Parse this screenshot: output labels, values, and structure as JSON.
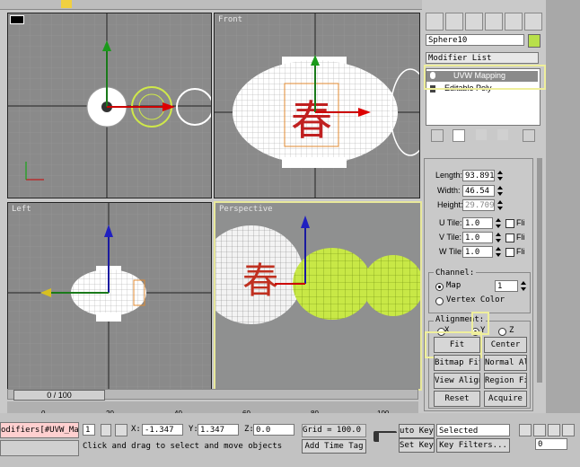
{
  "app": {
    "accent": "#e8e89a",
    "object_color": "#b8e04a"
  },
  "viewports": {
    "top_right_label": "Front",
    "bottom_left_label": "Left",
    "bottom_right_label": "Perspective",
    "lantern_text": "春"
  },
  "command_panel": {
    "object_name": "Sphere10",
    "modifier_list_label": "Modifier List",
    "stack": [
      {
        "label": "UVW Mapping"
      },
      {
        "label": "Editable Poly"
      }
    ]
  },
  "params": {
    "length_label": "Length:",
    "length_value": "93.891",
    "width_label": "Width:",
    "width_value": "46.54",
    "height_label": "Height:",
    "height_value": "29.709",
    "utile_label": "U Tile:",
    "utile_value": "1.0",
    "vtile_label": "V Tile:",
    "vtile_value": "1.0",
    "wtile_label": "W Tile:",
    "wtile_value": "1.0",
    "flip_label": "Fli",
    "channel_label": "Channel:",
    "map_label": "Map",
    "map_value": "1",
    "vertex_color_label": "Vertex Color",
    "alignment_label": "Alignment:",
    "align_x": "X",
    "align_y": "Y",
    "align_z": "Z",
    "fit_label": "Fit",
    "center_label": "Center",
    "bitmap_fit_label": "Bitmap Fit",
    "normal_align_label": "Normal Align",
    "view_align_label": "View Align",
    "region_fit_label": "Region Fit",
    "reset_label": "Reset",
    "acquire_label": "Acquire"
  },
  "timeline": {
    "frame_label": "0 / 100",
    "ticks": [
      "0",
      "20",
      "40",
      "60",
      "80",
      "100"
    ]
  },
  "status": {
    "modifier_text": "odifiers[#UVW_Ma",
    "selected_count": "1",
    "x_label": "X:",
    "x_value": "-1.347",
    "y_label": "Y:",
    "y_value": "1.347",
    "z_label": "Z:",
    "z_value": "0.0",
    "grid_label": "Grid = 100.0",
    "prompt": "Click and drag to select and move objects",
    "add_time_tag": "Add Time Tag",
    "auto_key": "uto Key",
    "set_key": "Set Key",
    "selected_dropdown": "Selected",
    "key_filters": "Key Filters...",
    "current_frame": "0"
  }
}
